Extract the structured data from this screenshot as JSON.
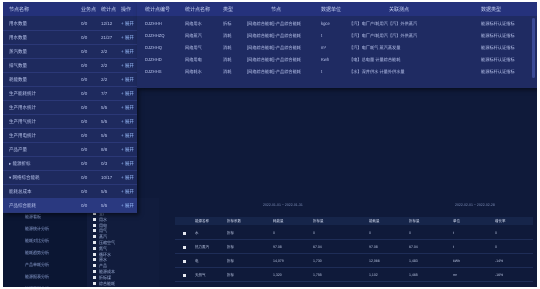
{
  "node_table": {
    "headers": [
      "节点名称",
      "业务点",
      "统计点",
      "操作"
    ],
    "rows": [
      {
        "name": "用水数量",
        "biz": "0/0",
        "stat": "12/12",
        "op": "+ 展开"
      },
      {
        "name": "用水数量",
        "biz": "0/0",
        "stat": "21/27",
        "op": "+ 展开"
      },
      {
        "name": "蒸汽数量",
        "biz": "0/0",
        "stat": "2/2",
        "op": "+ 展开"
      },
      {
        "name": "排气数量",
        "biz": "0/0",
        "stat": "2/2",
        "op": "+ 展开"
      },
      {
        "name": "耗能数量",
        "biz": "0/0",
        "stat": "2/2",
        "op": "+ 展开"
      },
      {
        "name": "生产能耗统计",
        "biz": "0/0",
        "stat": "7/7",
        "op": "+ 展开"
      },
      {
        "name": "生产用水统计",
        "biz": "0/0",
        "stat": "5/5",
        "op": "+ 展开"
      },
      {
        "name": "生产用气统计",
        "biz": "0/0",
        "stat": "5/5",
        "op": "+ 展开"
      },
      {
        "name": "生产用电统计",
        "biz": "0/0",
        "stat": "5/5",
        "op": "+ 展开"
      },
      {
        "name": "产品产量",
        "biz": "0/0",
        "stat": "8/8",
        "op": "+ 展开"
      },
      {
        "name": "▸ 能源折标",
        "biz": "0/0",
        "stat": "0/3",
        "op": "+ 展开"
      },
      {
        "name": "▾ 网络综合能耗",
        "biz": "0/0",
        "stat": "10/17",
        "op": "+ 展开"
      },
      {
        "name": "能耗总成本",
        "biz": "0/0",
        "stat": "5/5",
        "op": "+ 展开"
      },
      {
        "name": "产品综合能耗",
        "biz": "0/0",
        "stat": "5/5",
        "op": "+ 展开"
      }
    ]
  },
  "detail_table": {
    "headers": [
      "统计点编号",
      "统计点名称",
      "类型",
      "节点",
      "数据单位",
      "关联测点",
      "数据类型"
    ],
    "rows": [
      {
        "code": "DJZHHH",
        "name": "网络用水",
        "type": "折标",
        "node": "[网络综合能耗]-产品综合能耗",
        "unit": "kgce",
        "points": "【汽】电厂产/耗用汽【汽】外供蒸汽",
        "dtype": "能源标杆认证指标"
      },
      {
        "code": "DJZHHZQ",
        "name": "网络蒸汽",
        "type": "消耗",
        "node": "[网络综合能耗]-产品综合能耗",
        "unit": "t",
        "points": "【汽】电厂产/耗用汽【汽】外供蒸汽",
        "dtype": "能源标杆认证指标"
      },
      {
        "code": "DJZHHQ",
        "name": "网络用气",
        "type": "消耗",
        "node": "[网络综合能耗]-产品综合能耗",
        "unit": "m³",
        "points": "【汽】电厂耗气 蒸汽蒸发量",
        "dtype": "能源标杆认证指标"
      },
      {
        "code": "DJZHHD",
        "name": "网络用电",
        "type": "消耗",
        "node": "[网络综合能耗]-产品综合能耗",
        "unit": "Kwh",
        "points": "【电】总电量 计量综合能耗",
        "dtype": "能源标杆认证指标"
      },
      {
        "code": "DJZHHS",
        "name": "网络耗水",
        "type": "消耗",
        "node": "[网络综合能耗]-产品综合能耗",
        "unit": "t",
        "points": "【水】深井供水 计量外供水量",
        "dtype": "能源标杆认证指标"
      }
    ]
  },
  "bg_sidebar": {
    "items": [
      "能源看板",
      "能源统计分析",
      "能耗对比分析",
      "能耗趋势分析",
      "产品单耗分析",
      "能源报表分析",
      "能源平衡分析"
    ]
  },
  "bg_tree": {
    "items": [
      "全厂",
      "用水",
      "用电",
      "用气",
      "蒸汽",
      "压缩空气",
      "氮气",
      "循环水",
      "原水",
      "产品",
      "能源成本",
      "折标煤",
      "综合能耗"
    ]
  },
  "bg_table": {
    "dates": [
      "2022-01-01 ~ 2022-01-31",
      "2022-02-01 ~ 2022-02-28"
    ],
    "headers": [
      "能源名称",
      "折标系数",
      "耗能量",
      "折标量",
      "能耗量",
      "折标量",
      "单位",
      "增长率"
    ],
    "rows": [
      [
        "水",
        "折标",
        "0",
        "0",
        "0",
        "0",
        "t",
        "0"
      ],
      [
        "热力蒸汽",
        "折标",
        "97.08",
        "67.04",
        "97.08",
        "67.04",
        "t",
        "0"
      ],
      [
        "电",
        "折标",
        "14,079",
        "1,730",
        "12,066",
        "1,483",
        "kWh",
        "-14%"
      ],
      [
        "天然气",
        "折标",
        "1,320",
        "1,755",
        "1,102",
        "1,465",
        "m³",
        "-16%"
      ]
    ]
  },
  "colors": {
    "bg": "#0f1a3a",
    "panel": "#1e2a5e",
    "header": "#24317a",
    "link": "#9cc0ff"
  }
}
